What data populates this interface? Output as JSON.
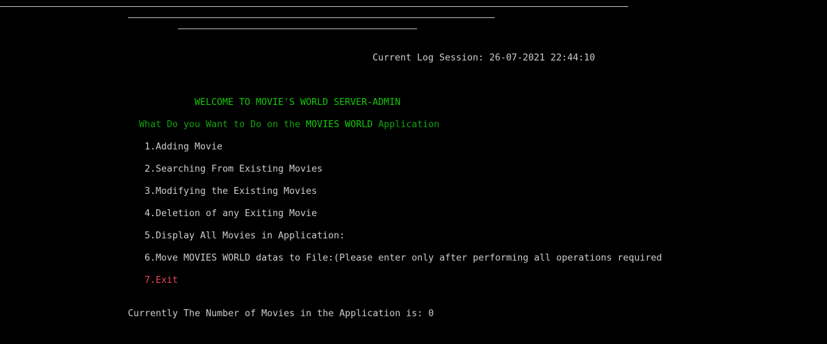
{
  "colors": {
    "background": "#000000",
    "text": "#cccccc",
    "bright_green": "#16c60c",
    "dark_green": "#13a10e",
    "red": "#e74856"
  },
  "session": {
    "label": "Current Log Session: ",
    "timestamp": "26-07-2021 22:44:10"
  },
  "welcome": "WELCOME TO MOVIE'S WORLD SERVER-ADMIN",
  "prompt": {
    "before": "What Do you Want to Do on the ",
    "highlight": "MOVIES WORLD",
    "after": " Application"
  },
  "menu": [
    "1.Adding Movie",
    "2.Searching From Existing Movies",
    "3.Modifying the Existing Movies",
    "4.Deletion of any Exiting Movie",
    "5.Display All Movies in Application:",
    "6.Move MOVIES WORLD datas to File:(Please enter only after performing all operations required",
    "7.Exit"
  ],
  "status": {
    "label": "Currently The Number of Movies in the Application is: ",
    "count": "0"
  }
}
